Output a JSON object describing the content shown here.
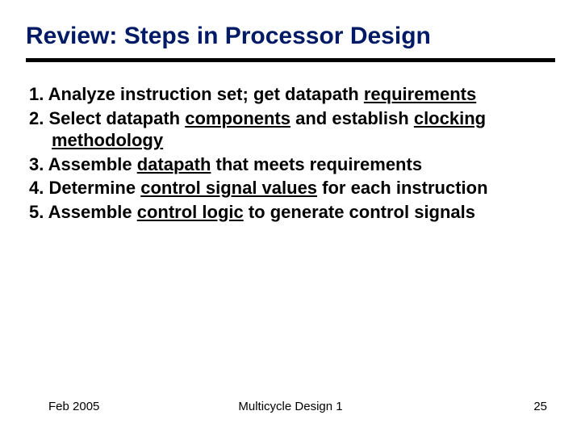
{
  "title": "Review: Steps in Processor Design",
  "steps": {
    "s1a": "Analyze instruction set; get datapath ",
    "s1b": "requirements",
    "s2a": "Select datapath ",
    "s2b": "components",
    "s2c": " and establish ",
    "s2d": "clocking methodology",
    "s3a": "Assemble ",
    "s3b": "datapath",
    "s3c": " that meets requirements",
    "s4a": "Determine ",
    "s4b": "control signal values",
    "s4c": " for each instruction",
    "s5a": "Assemble ",
    "s5b": "control logic",
    "s5c": " to generate control signals"
  },
  "footer": {
    "date": "Feb 2005",
    "center": "Multicycle Design 1",
    "page": "25"
  }
}
